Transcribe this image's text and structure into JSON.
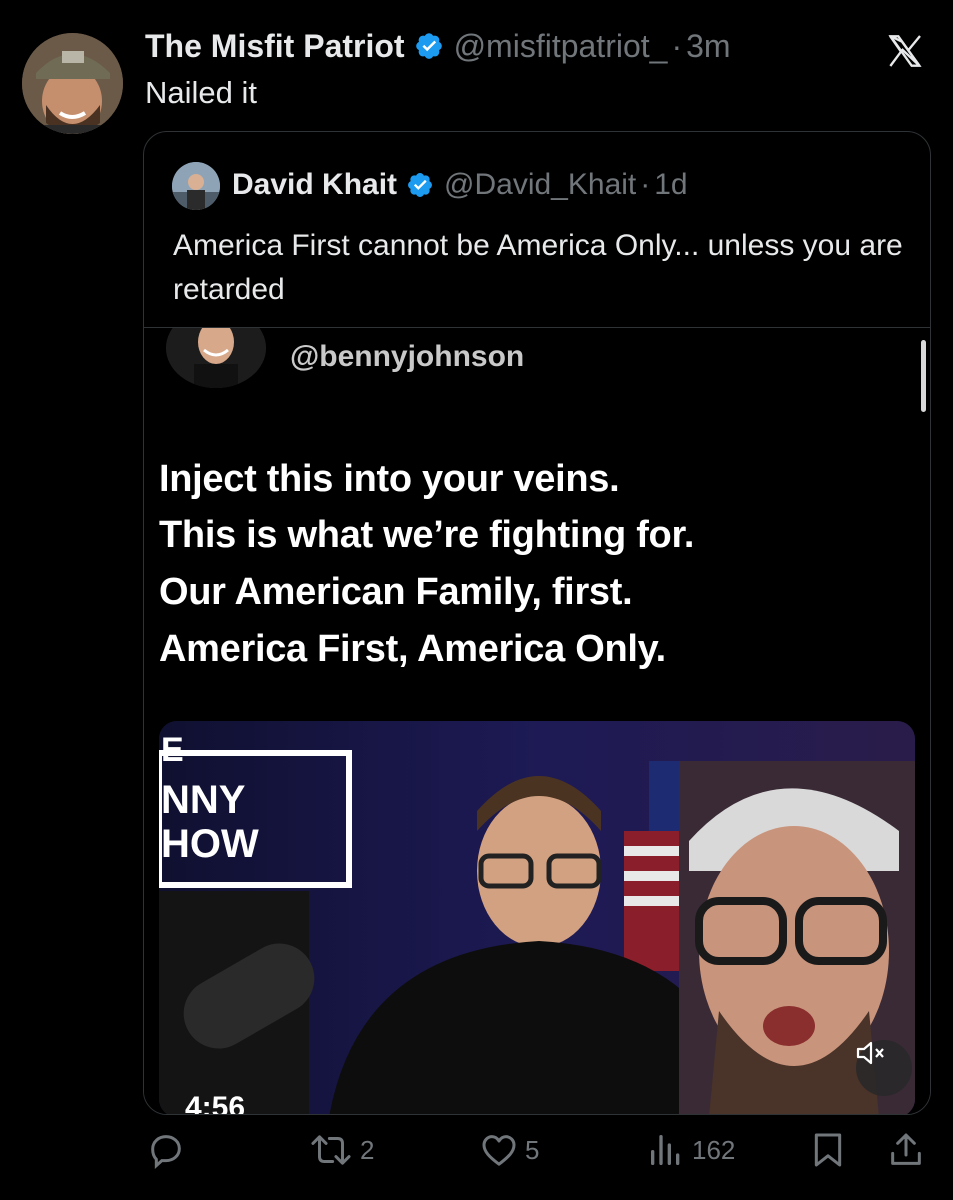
{
  "tweet": {
    "author_name": "The Misfit Patriot",
    "author_handle": "@misfitpatriot_",
    "separator": "·",
    "time": "3m",
    "text": "Nailed it"
  },
  "quote": {
    "author_name": "David Khait",
    "author_handle": "@David_Khait",
    "separator": "·",
    "time": "1d",
    "text": "America First cannot be America Only... unless you are retarded"
  },
  "embedded": {
    "handle": "@bennyjohnson",
    "lines": [
      "Inject this into your veins.",
      "This is what we’re fighting for.",
      "Our American Family, first.",
      "America First, America Only."
    ],
    "video_overlay_text": [
      "E",
      "NNY",
      "HOW"
    ],
    "duration": "4:56"
  },
  "actions": {
    "reply_count": "",
    "retweet_count": "2",
    "like_count": "5",
    "views_count": "162"
  },
  "icons": {
    "verified": "verified-badge-icon",
    "brand": "x-logo-icon",
    "reply": "reply-icon",
    "retweet": "retweet-icon",
    "like": "heart-icon",
    "views": "views-icon",
    "bookmark": "bookmark-icon",
    "share": "share-icon",
    "mute": "muted-speaker-icon"
  },
  "colors": {
    "background": "#000000",
    "text_primary": "#e7e9ea",
    "text_secondary": "#71767b",
    "verified_blue": "#1d9bf0",
    "border": "#2f3336"
  }
}
